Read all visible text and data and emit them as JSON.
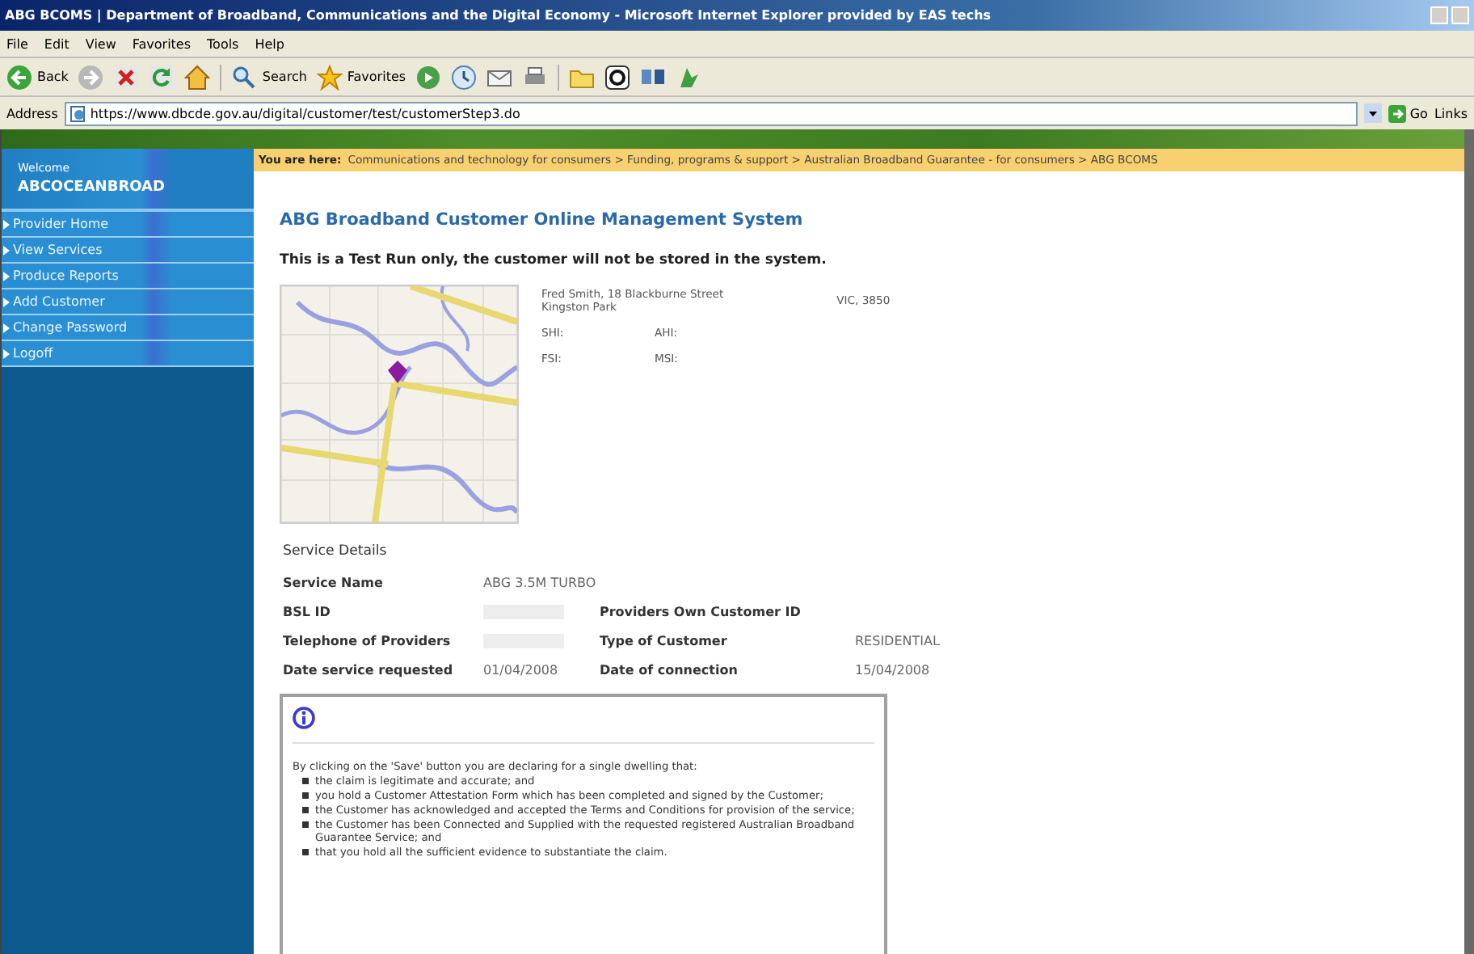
{
  "window": {
    "title": "ABG BCOMS | Department of Broadband, Communications and the Digital Economy - Microsoft Internet Explorer provided by EAS techs"
  },
  "menu": [
    "File",
    "Edit",
    "View",
    "Favorites",
    "Tools",
    "Help"
  ],
  "toolbar": {
    "back": "Back",
    "search": "Search",
    "favorites": "Favorites"
  },
  "address_bar": {
    "label": "Address",
    "url": "https://www.dbcde.gov.au/digital/customer/test/customerStep3.do",
    "go": "Go",
    "links": "Links"
  },
  "breadcrumb": {
    "label": "You are here:",
    "path": "Communications and technology for consumers  >  Funding, programs & support  >  Australian Broadband Guarantee - for consumers  >  ABG BCOMS"
  },
  "sidebar": {
    "welcome": "Welcome",
    "user": "ABCOCEANBROAD",
    "items": [
      "Provider Home",
      "View Services",
      "Produce Reports",
      "Add Customer",
      "Change Password",
      "Logoff"
    ]
  },
  "page": {
    "heading": "ABG Broadband Customer Online Management System",
    "notice": "This is a Test Run only, the customer will not be stored in the system.",
    "map": {
      "kind": "picture"
    },
    "address": {
      "line1": "Fred Smith, 18 Blackburne Street",
      "line2": "Kingston Park",
      "state": "VIC, 3850"
    },
    "coords": [
      [
        "SHI:",
        "AHI:"
      ],
      [
        "FSI:",
        "MSI:"
      ]
    ]
  },
  "service_details": {
    "title": "Service Details",
    "rows": [
      [
        {
          "kind": "label",
          "text": "Service Name"
        },
        {
          "kind": "value",
          "text": "ABG 3.5M TURBO"
        }
      ],
      [
        {
          "kind": "label",
          "text": "BSL ID"
        },
        {
          "kind": "redacted"
        },
        {
          "kind": "label",
          "text": "Providers Own Customer ID"
        }
      ],
      [
        {
          "kind": "label",
          "text": "Telephone of Providers"
        },
        {
          "kind": "redacted"
        },
        {
          "kind": "label",
          "text": "Type of Customer"
        },
        {
          "kind": "value",
          "text": "RESIDENTIAL"
        }
      ],
      [
        {
          "kind": "label",
          "text": "Date service requested"
        },
        {
          "kind": "value",
          "text": "01/04/2008"
        },
        {
          "kind": "label",
          "text": "Date of connection"
        },
        {
          "kind": "value",
          "text": "15/04/2008"
        }
      ]
    ]
  },
  "info": {
    "intro": "By clicking on the 'Save' button you are declaring for a single dwelling that:",
    "bullets": [
      "the claim is legitimate and accurate; and",
      "you hold a Customer Attestation Form which has been completed and signed by the Customer;",
      "the Customer has acknowledged and accepted the Terms and Conditions for provision of the service;",
      "the Customer has been Connected and Supplied with the requested registered Australian Broadband Guarantee Service; and",
      "that you hold all the sufficient evidence to substantiate the claim."
    ]
  }
}
